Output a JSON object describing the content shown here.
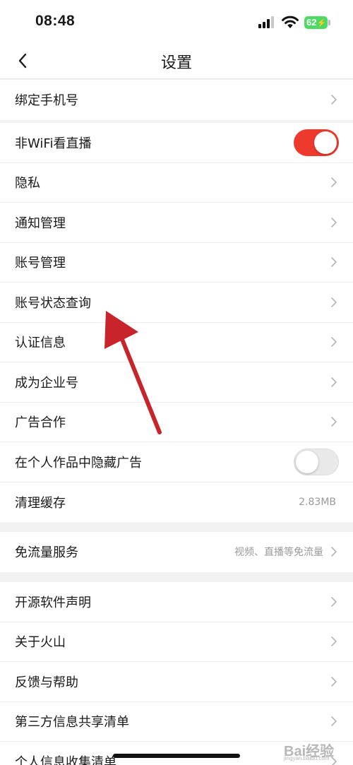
{
  "status_bar": {
    "time": "08:48",
    "battery": "62"
  },
  "nav": {
    "title": "设置"
  },
  "group1": [
    {
      "label": "绑定手机号",
      "type": "chevron"
    }
  ],
  "group2": [
    {
      "label": "非WiFi看直播",
      "type": "toggle",
      "state": "on"
    },
    {
      "label": "隐私",
      "type": "chevron"
    },
    {
      "label": "通知管理",
      "type": "chevron"
    },
    {
      "label": "账号管理",
      "type": "chevron"
    },
    {
      "label": "账号状态查询",
      "type": "chevron"
    },
    {
      "label": "认证信息",
      "type": "chevron"
    },
    {
      "label": "成为企业号",
      "type": "chevron"
    },
    {
      "label": "广告合作",
      "type": "chevron"
    },
    {
      "label": "在个人作品中隐藏广告",
      "type": "toggle",
      "state": "off"
    },
    {
      "label": "清理缓存",
      "type": "value",
      "value": "2.83MB"
    }
  ],
  "group3": [
    {
      "label": "免流量服务",
      "type": "value-chevron",
      "value": "视频、直播等免流量"
    }
  ],
  "group4": [
    {
      "label": "开源软件声明",
      "type": "chevron"
    },
    {
      "label": "关于火山",
      "type": "chevron"
    },
    {
      "label": "反馈与帮助",
      "type": "chevron"
    },
    {
      "label": "第三方信息共享清单",
      "type": "chevron"
    },
    {
      "label": "个人信息收集清单",
      "type": "chevron"
    }
  ],
  "watermark": {
    "main": "Bai经验",
    "sub": "jingyan.baidu.com"
  },
  "colors": {
    "accent": "#ee3a2d",
    "battery": "#4cd964",
    "annotation_arrow": "#c8242b"
  }
}
